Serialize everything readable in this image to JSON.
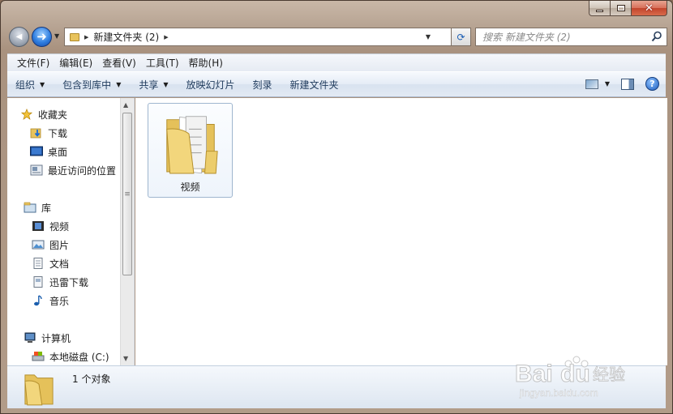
{
  "window": {
    "caption_min_icon": "minimize-icon",
    "caption_max_icon": "maximize-icon",
    "caption_close_glyph": "✕"
  },
  "nav": {
    "back_glyph": "◀",
    "forward_glyph": "➜",
    "address": {
      "path": "新建文件夹 (2)"
    },
    "search_placeholder": "搜索 新建文件夹 (2)"
  },
  "menu": [
    {
      "label": "文件(F)"
    },
    {
      "label": "编辑(E)"
    },
    {
      "label": "查看(V)"
    },
    {
      "label": "工具(T)"
    },
    {
      "label": "帮助(H)"
    }
  ],
  "commands": [
    {
      "label": "组织",
      "dropdown": true
    },
    {
      "label": "包含到库中",
      "dropdown": true
    },
    {
      "label": "共享",
      "dropdown": true
    },
    {
      "label": "放映幻灯片",
      "dropdown": false
    },
    {
      "label": "刻录",
      "dropdown": false
    },
    {
      "label": "新建文件夹",
      "dropdown": false
    }
  ],
  "sidebar": {
    "favorites": {
      "label": "收藏夹",
      "icon": "star-icon",
      "items": [
        {
          "label": "下载",
          "icon": "downloads-folder-icon"
        },
        {
          "label": "桌面",
          "icon": "desktop-icon"
        },
        {
          "label": "最近访问的位置",
          "icon": "recent-places-icon"
        }
      ]
    },
    "libraries": {
      "label": "库",
      "icon": "library-icon",
      "items": [
        {
          "label": "视频",
          "icon": "video-icon"
        },
        {
          "label": "图片",
          "icon": "picture-icon"
        },
        {
          "label": "文档",
          "icon": "document-icon"
        },
        {
          "label": "迅雷下载",
          "icon": "thunder-download-icon"
        },
        {
          "label": "音乐",
          "icon": "music-icon"
        }
      ]
    },
    "computer": {
      "label": "计算机",
      "icon": "computer-icon",
      "items": [
        {
          "label": "本地磁盘 (C:)",
          "icon": "local-disk-icon"
        }
      ]
    }
  },
  "content": {
    "items": [
      {
        "label": "视频",
        "icon": "folder-icon",
        "selected": true
      }
    ]
  },
  "details": {
    "count_text": "1 个对象"
  },
  "colors": {
    "window_frame": "#b29c89",
    "accent_blue": "#2f7ee0",
    "folder_yellow": "#e8c35c"
  }
}
